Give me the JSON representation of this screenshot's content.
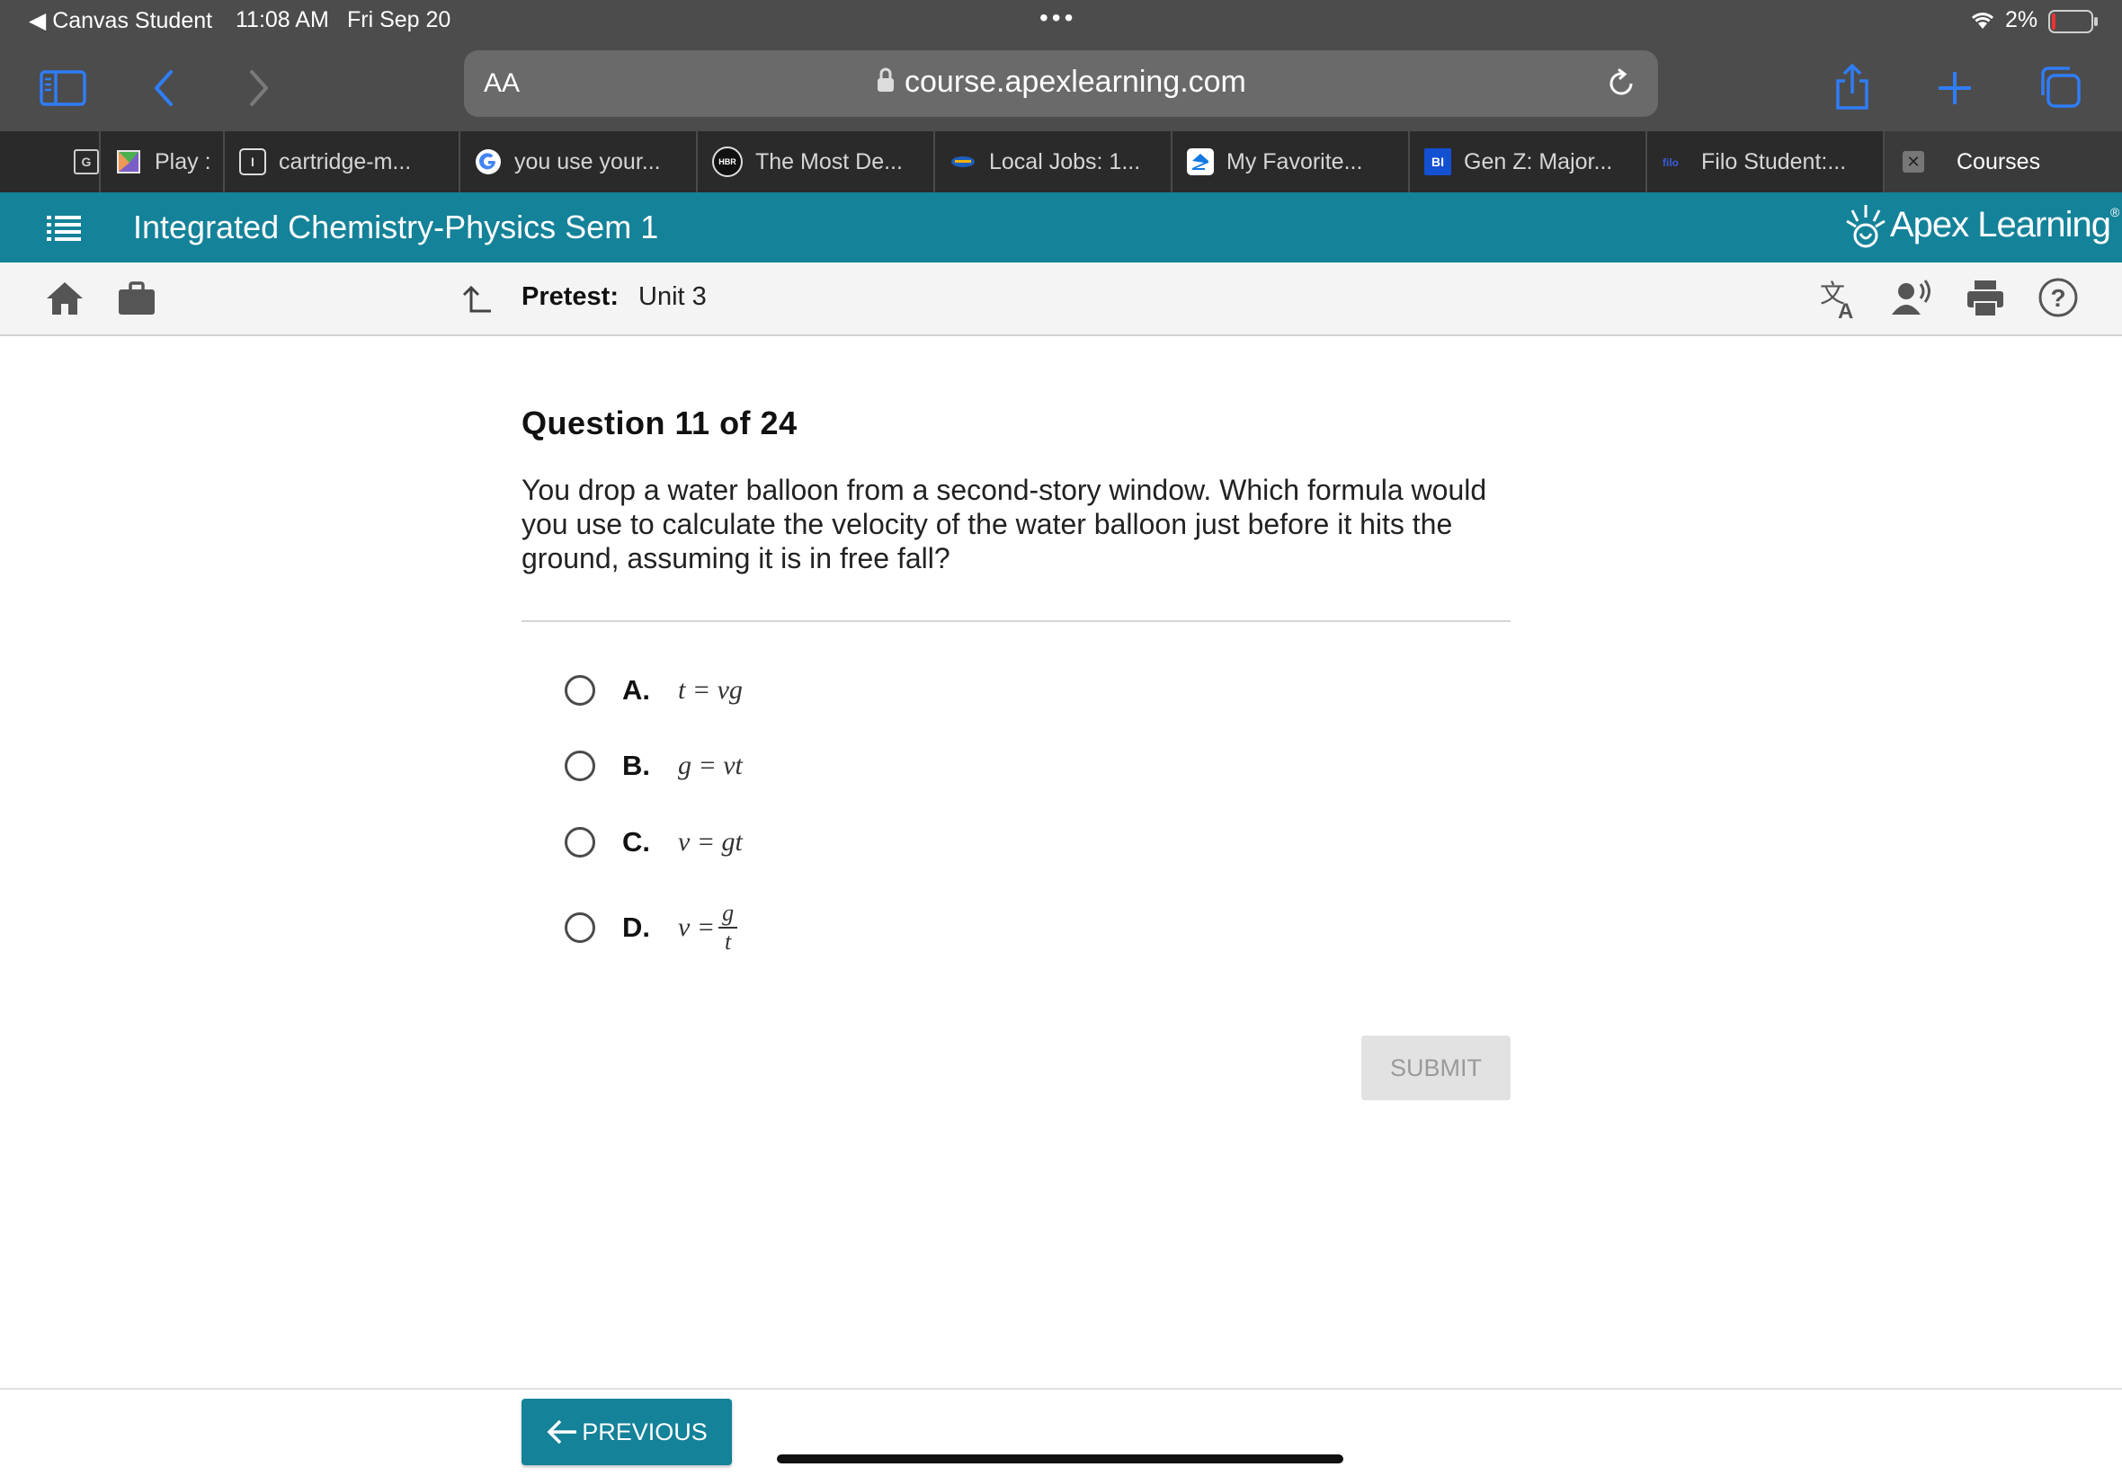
{
  "status_bar": {
    "back_app": "Canvas Student",
    "time": "11:08 AM",
    "date": "Fri Sep 20",
    "battery": "2%"
  },
  "browser": {
    "reader_label": "AA",
    "url": "course.apexlearning.com",
    "tabs": [
      {
        "label": "Play :",
        "favicon": "play-icon"
      },
      {
        "label": "cartridge-m...",
        "favicon": "I"
      },
      {
        "label": "you use your...",
        "favicon": "google"
      },
      {
        "label": "The Most De...",
        "favicon": "HBR"
      },
      {
        "label": "Local Jobs: 1...",
        "favicon": "local-jobs"
      },
      {
        "label": "My Favorite...",
        "favicon": "zillow"
      },
      {
        "label": "Gen Z: Major...",
        "favicon": "BI"
      },
      {
        "label": "Filo Student:...",
        "favicon": "filo"
      },
      {
        "label": "Courses",
        "favicon": "close"
      }
    ],
    "first_tab_favicon": "G"
  },
  "course": {
    "title": "Integrated Chemistry-Physics Sem 1",
    "brand": "Apex Learning",
    "brand_mark": "®"
  },
  "activity": {
    "type_label": "Pretest:",
    "unit": "Unit 3"
  },
  "question": {
    "heading": "Question 11 of 24",
    "text": "You drop a water balloon from a second-story window. Which formula would you use to calculate the velocity of the water balloon just before it hits the ground, assuming it is in free fall?",
    "choices": [
      {
        "letter": "A.",
        "formula": "t = vg"
      },
      {
        "letter": "B.",
        "formula": "g = vt"
      },
      {
        "letter": "C.",
        "formula": "v = gt"
      },
      {
        "letter": "D.",
        "lhs": "v =",
        "numerator": "g",
        "denominator": "t"
      }
    ],
    "selected": null
  },
  "actions": {
    "submit": "SUBMIT",
    "previous": "PREVIOUS"
  },
  "colors": {
    "teal": "#148299",
    "browser_chrome": "#4c4c4c",
    "tab_strip": "#2a2a2a",
    "ios_blue": "#2f7df6"
  }
}
